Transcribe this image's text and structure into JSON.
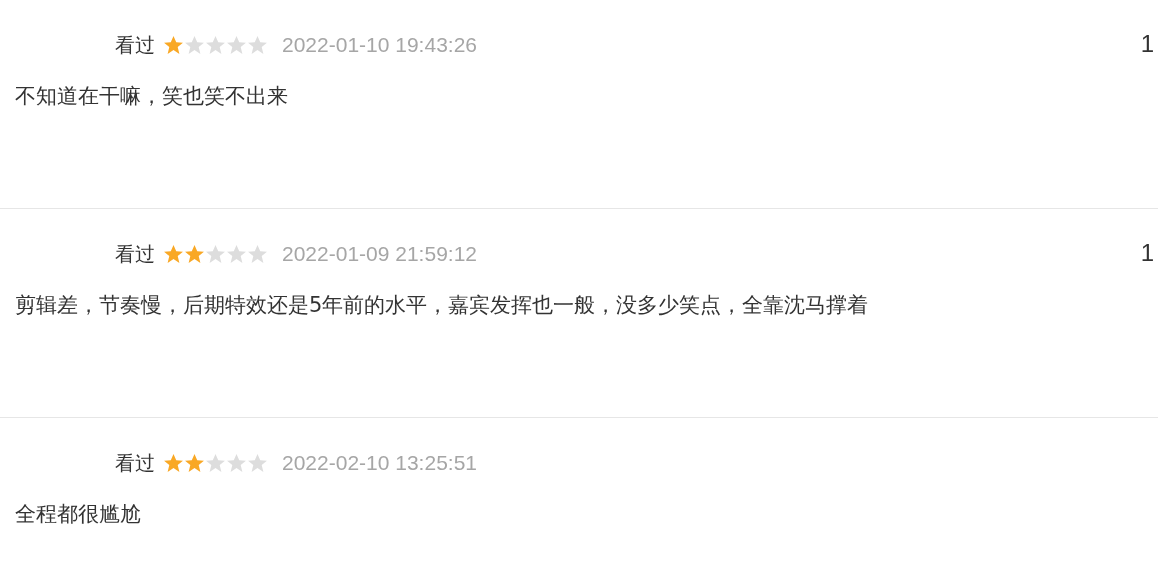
{
  "reviews": [
    {
      "status": "看过",
      "stars": 1,
      "time": "2022-01-10 19:43:26",
      "votes": "1",
      "text": "不知道在干嘛，笑也笑不出来"
    },
    {
      "status": "看过",
      "stars": 2,
      "time": "2022-01-09 21:59:12",
      "votes": "1",
      "text": "剪辑差，节奏慢，后期特效还是5年前的水平，嘉宾发挥也一般，没多少笑点，全靠沈马撑着"
    },
    {
      "status": "看过",
      "stars": 2,
      "time": "2022-02-10 13:25:51",
      "text": "全程都很尴尬"
    }
  ]
}
